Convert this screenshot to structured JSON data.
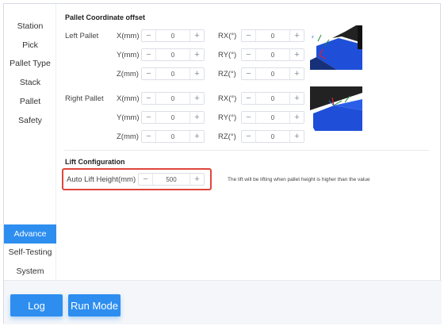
{
  "sidebar": {
    "items": [
      {
        "label": "Station"
      },
      {
        "label": "Pick"
      },
      {
        "label": "Pallet Type"
      },
      {
        "label": "Stack"
      },
      {
        "label": "Pallet"
      },
      {
        "label": "Safety"
      },
      {
        "label": "Advance",
        "active": true
      },
      {
        "label": "Self-Testing"
      },
      {
        "label": "System"
      }
    ]
  },
  "pallet_offset": {
    "title": "Pallet Coordinate offset",
    "left_label": "Left Pallet",
    "right_label": "Right Pallet",
    "left": {
      "x_label": "X(mm)",
      "x": "0",
      "y_label": "Y(mm)",
      "y": "0",
      "z_label": "Z(mm)",
      "z": "0",
      "rx_label": "RX(°)",
      "rx": "0",
      "ry_label": "RY(°)",
      "ry": "0",
      "rz_label": "RZ(°)",
      "rz": "0"
    },
    "right": {
      "x_label": "X(mm)",
      "x": "0",
      "y_label": "Y(mm)",
      "y": "0",
      "z_label": "Z(mm)",
      "z": "0",
      "rx_label": "RX(°)",
      "rx": "0",
      "ry_label": "RY(°)",
      "ry": "0",
      "rz_label": "RZ(°)",
      "rz": "0"
    }
  },
  "lift": {
    "title": "Lift Configuration",
    "auto_label": "Auto Lift Height(mm)",
    "auto_value": "500",
    "hint": "The lift will be lifting when pallet height is higher than the value"
  },
  "stepper": {
    "minus": "−",
    "plus": "+"
  },
  "footer": {
    "log_label": "Log",
    "run_label": "Run Mode"
  },
  "colors": {
    "accent": "#2d8ef0",
    "highlight": "#e0463c",
    "pallet": "#1f4fd8"
  }
}
